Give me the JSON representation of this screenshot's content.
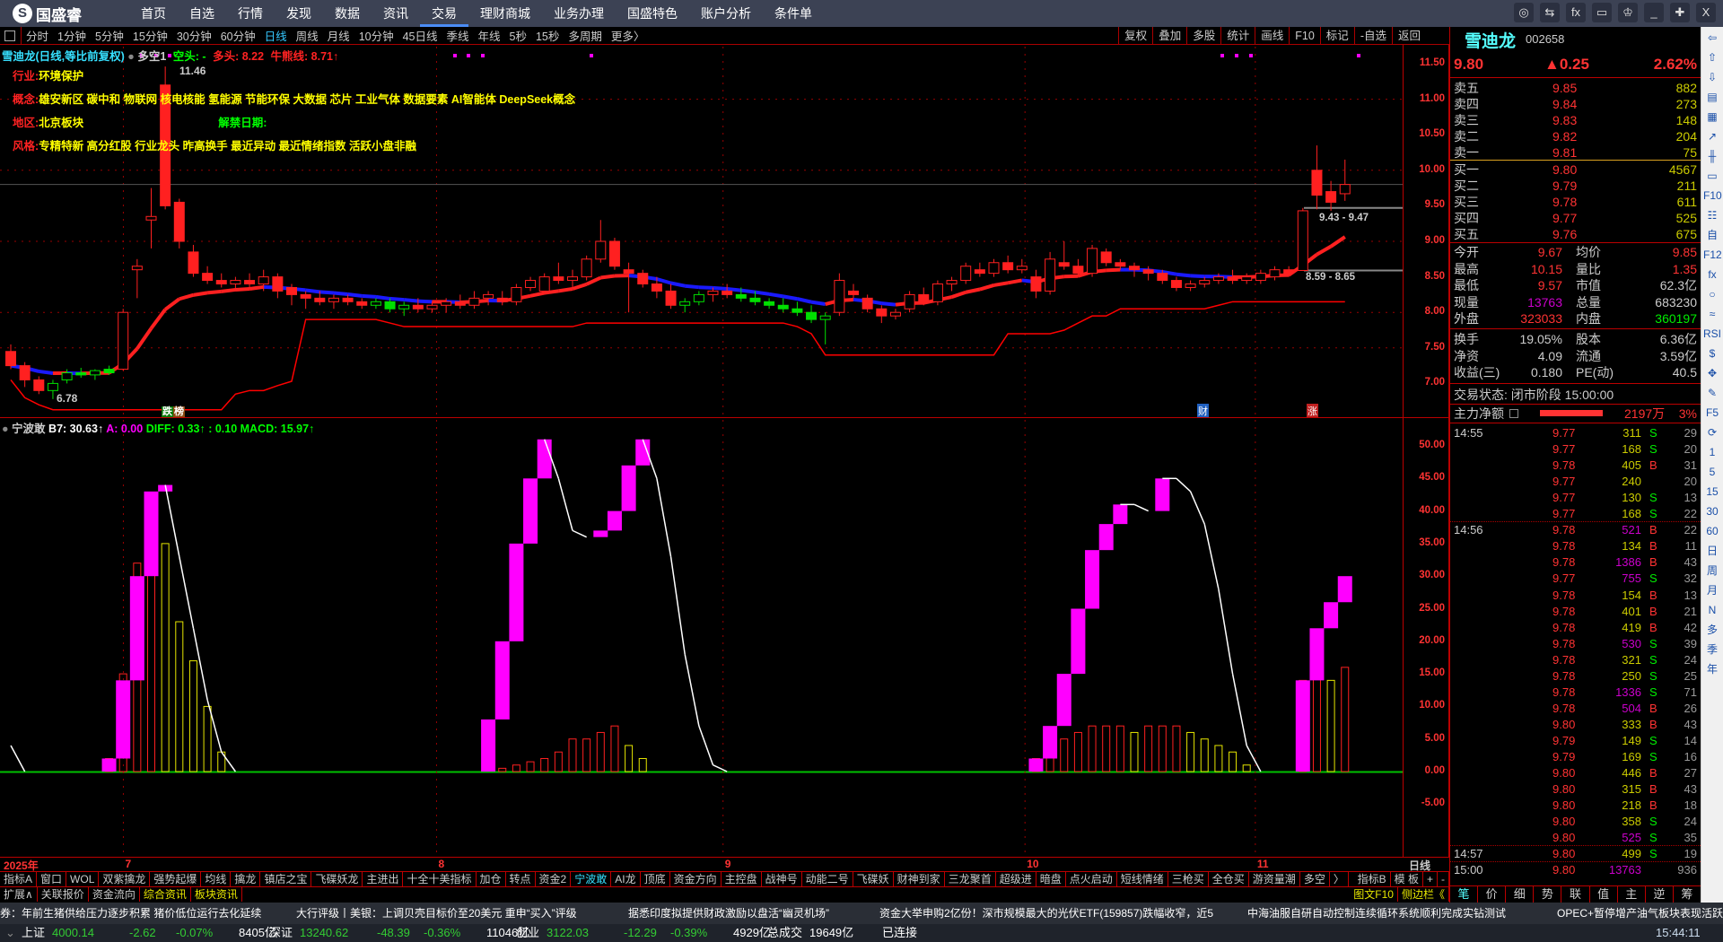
{
  "app": {
    "logo": "国盛睿",
    "nav": [
      "首页",
      "自选",
      "行情",
      "发现",
      "数据",
      "资讯",
      "交易",
      "理财商城",
      "业务办理",
      "国盛特色",
      "账户分析",
      "条件单"
    ],
    "nav_active": 6,
    "window_buttons": [
      "◎",
      "⇆",
      "fx",
      "▭",
      "♔",
      "_",
      "✚",
      "X"
    ]
  },
  "toolbar": {
    "periods": [
      "分时",
      "1分钟",
      "5分钟",
      "15分钟",
      "30分钟",
      "60分钟",
      "日线",
      "周线",
      "月线",
      "10分钟",
      "45日线",
      "季线",
      "年线",
      "5秒",
      "15秒",
      "多周期",
      "更多〉"
    ],
    "active": 6,
    "tools": [
      "复权",
      "叠加",
      "多股",
      "统计",
      "画线",
      "F10",
      "标记",
      "-自选",
      "返回"
    ]
  },
  "main_header": {
    "title": "雪迪龙(日线,等比前复权)",
    "indicator": "多空1",
    "bear": "空头: -",
    "bull": "多头: 8.22",
    "line": "牛熊线: 8.71↑"
  },
  "info": {
    "industry_label": "行业:",
    "industry": "环境保护",
    "concept_label": "概念:",
    "concept": "雄安新区 碳中和 物联网 核电核能 氢能源 节能环保 大数据 芯片 工业气体 数据要素 AI智能体 DeepSeek概念",
    "region_label": "地区:",
    "region": "北京板块",
    "unlock_label": "解禁日期:",
    "style_label": "风格:",
    "style": "专精特新 高分红股 行业龙头 昨高换手 最近异动 最近情绪指数 活跃小盘非融"
  },
  "markers": {
    "high": "11.46",
    "low": "6.78",
    "zone_upper": "9.43 - 9.47",
    "zone_lower": "8.59 - 8.65",
    "badge1": "跌",
    "badge2": "榜",
    "badge_cai": "财",
    "badge_zhang": "涨"
  },
  "price_axis": [
    "11.50",
    "11.00",
    "10.50",
    "10.00",
    "9.50",
    "9.00",
    "8.50",
    "8.00",
    "7.50",
    "7.00"
  ],
  "ind_axis": [
    "50.00",
    "45.00",
    "40.00",
    "35.00",
    "30.00",
    "25.00",
    "20.00",
    "15.00",
    "10.00",
    "5.00",
    "0.00",
    "-5.00"
  ],
  "indicator_header": {
    "name": "宁波敢",
    "b7": "B7: 30.63↑",
    "a": "A: 0.00",
    "diff": "DIFF: 0.33↑",
    "dea": ": 0.10",
    "macd": "MACD: 15.97↑"
  },
  "date_axis": {
    "year": "2025年",
    "months": [
      "7",
      "8",
      "9",
      "10",
      "11"
    ],
    "period": "日线"
  },
  "colors": {
    "up": "#ff2020",
    "down": "#00e000",
    "ma_down": "#1a1aff",
    "magenta": "#ff00ff",
    "yellow": "#e6e600"
  },
  "kline": {
    "ohlc": [
      [
        7.45,
        7.55,
        7.2,
        7.25
      ],
      [
        7.25,
        7.3,
        6.95,
        7.05
      ],
      [
        7.05,
        7.1,
        6.85,
        6.9
      ],
      [
        6.9,
        7.05,
        6.78,
        7.0
      ],
      [
        7.05,
        7.2,
        7.0,
        7.15
      ],
      [
        7.15,
        7.22,
        7.08,
        7.12
      ],
      [
        7.12,
        7.2,
        7.05,
        7.18
      ],
      [
        7.2,
        7.25,
        7.12,
        7.15
      ],
      [
        7.2,
        8.05,
        7.18,
        8.0
      ],
      [
        8.6,
        8.75,
        8.2,
        8.65
      ],
      [
        9.3,
        9.75,
        8.9,
        9.35
      ],
      [
        11.2,
        11.46,
        9.45,
        9.5
      ],
      [
        9.55,
        9.6,
        8.9,
        9.0
      ],
      [
        8.85,
        8.95,
        8.5,
        8.55
      ],
      [
        8.55,
        8.65,
        8.4,
        8.45
      ],
      [
        8.45,
        8.55,
        8.35,
        8.4
      ],
      [
        8.4,
        8.5,
        8.3,
        8.45
      ],
      [
        8.45,
        8.55,
        8.35,
        8.4
      ],
      [
        8.4,
        8.6,
        8.3,
        8.5
      ],
      [
        8.5,
        8.55,
        8.2,
        8.3
      ],
      [
        8.35,
        8.4,
        8.1,
        8.25
      ],
      [
        8.25,
        8.3,
        8.05,
        8.2
      ],
      [
        8.2,
        8.3,
        8.1,
        8.15
      ],
      [
        8.15,
        8.25,
        8.05,
        8.2
      ],
      [
        8.2,
        8.25,
        8.1,
        8.15
      ],
      [
        8.15,
        8.2,
        8.05,
        8.1
      ],
      [
        8.1,
        8.2,
        8.05,
        8.15
      ],
      [
        8.15,
        8.2,
        8.0,
        8.05
      ],
      [
        8.05,
        8.15,
        7.95,
        8.1
      ],
      [
        8.1,
        8.2,
        8.0,
        8.05
      ],
      [
        8.05,
        8.15,
        8.0,
        8.1
      ],
      [
        8.1,
        8.2,
        8.0,
        8.15
      ],
      [
        8.15,
        8.25,
        8.05,
        8.1
      ],
      [
        8.1,
        8.3,
        8.05,
        8.2
      ],
      [
        8.2,
        8.3,
        8.1,
        8.25
      ],
      [
        8.2,
        8.3,
        8.1,
        8.15
      ],
      [
        8.15,
        8.4,
        8.1,
        8.35
      ],
      [
        8.35,
        8.5,
        8.3,
        8.45
      ],
      [
        8.3,
        8.55,
        8.25,
        8.5
      ],
      [
        8.5,
        8.7,
        8.4,
        8.45
      ],
      [
        8.45,
        8.6,
        8.35,
        8.5
      ],
      [
        8.5,
        8.8,
        8.45,
        8.75
      ],
      [
        8.75,
        9.3,
        8.7,
        9.0
      ],
      [
        9.0,
        9.05,
        8.6,
        8.65
      ],
      [
        8.6,
        8.7,
        8.0,
        8.55
      ],
      [
        8.55,
        8.6,
        8.35,
        8.4
      ],
      [
        8.4,
        8.5,
        8.2,
        8.3
      ],
      [
        8.3,
        8.4,
        8.05,
        8.1
      ],
      [
        8.1,
        8.2,
        8.0,
        8.15
      ],
      [
        8.15,
        8.3,
        8.1,
        8.25
      ],
      [
        8.25,
        8.35,
        8.15,
        8.3
      ],
      [
        8.3,
        8.4,
        8.2,
        8.25
      ],
      [
        8.25,
        8.35,
        8.15,
        8.2
      ],
      [
        8.2,
        8.3,
        8.1,
        8.15
      ],
      [
        8.15,
        8.2,
        8.05,
        8.1
      ],
      [
        8.1,
        8.2,
        8.0,
        8.05
      ],
      [
        8.05,
        8.15,
        7.95,
        8.0
      ],
      [
        8.0,
        8.1,
        7.85,
        7.9
      ],
      [
        7.9,
        8.0,
        7.55,
        7.95
      ],
      [
        8.0,
        8.55,
        7.95,
        8.45
      ],
      [
        8.3,
        8.4,
        8.2,
        8.25
      ],
      [
        8.2,
        8.25,
        8.0,
        8.05
      ],
      [
        8.05,
        8.1,
        7.85,
        7.95
      ],
      [
        7.95,
        8.05,
        7.9,
        8.0
      ],
      [
        8.05,
        8.3,
        8.0,
        8.25
      ],
      [
        8.25,
        8.35,
        8.1,
        8.15
      ],
      [
        8.15,
        8.45,
        8.1,
        8.4
      ],
      [
        8.4,
        8.5,
        8.3,
        8.45
      ],
      [
        8.45,
        8.7,
        8.4,
        8.65
      ],
      [
        8.6,
        8.7,
        8.5,
        8.55
      ],
      [
        8.55,
        8.75,
        8.5,
        8.7
      ],
      [
        8.7,
        8.8,
        8.55,
        8.6
      ],
      [
        8.6,
        8.75,
        8.55,
        8.65
      ],
      [
        8.5,
        8.6,
        8.2,
        8.3
      ],
      [
        8.3,
        8.85,
        8.25,
        8.75
      ],
      [
        8.7,
        9.0,
        8.6,
        8.65
      ],
      [
        8.65,
        8.75,
        8.5,
        8.55
      ],
      [
        8.55,
        8.95,
        8.5,
        8.9
      ],
      [
        8.85,
        8.9,
        8.65,
        8.7
      ],
      [
        8.7,
        8.75,
        8.6,
        8.65
      ],
      [
        8.65,
        8.7,
        8.5,
        8.6
      ],
      [
        8.6,
        8.65,
        8.45,
        8.55
      ],
      [
        8.55,
        8.6,
        8.4,
        8.45
      ],
      [
        8.45,
        8.5,
        8.3,
        8.35
      ],
      [
        8.35,
        8.45,
        8.3,
        8.4
      ],
      [
        8.4,
        8.5,
        8.35,
        8.45
      ],
      [
        8.45,
        8.55,
        8.4,
        8.5
      ],
      [
        8.5,
        8.6,
        8.4,
        8.45
      ],
      [
        8.45,
        8.55,
        8.4,
        8.5
      ],
      [
        8.45,
        8.6,
        8.4,
        8.55
      ],
      [
        8.5,
        8.65,
        8.45,
        8.6
      ],
      [
        8.6,
        8.65,
        8.5,
        8.55
      ],
      [
        8.59,
        9.47,
        8.59,
        9.43
      ],
      [
        10.0,
        10.35,
        9.45,
        9.65
      ],
      [
        9.7,
        9.85,
        9.43,
        9.55
      ],
      [
        9.67,
        10.15,
        9.57,
        9.8
      ]
    ],
    "color_codes": "rrrgggggrrrrrrrrrrrrrrrrrrgggrrrrrrrrrrrrrrrrrrrggrrgggggggrrrrrrrrrrrrrrrrrrrrrrrrrrrrrrrrrrr",
    "last_price": 9.8,
    "month_start_index": [
      8.4,
      30.7,
      51.1,
      72.6,
      89
    ]
  },
  "indicator": {
    "b7": [
      4,
      0,
      0,
      0,
      0,
      0,
      0,
      2,
      14,
      30,
      43,
      44,
      33,
      22,
      11,
      3,
      0,
      0,
      0,
      0,
      0,
      0,
      0,
      0,
      0,
      0,
      0,
      0,
      0,
      0,
      0,
      0,
      0,
      0,
      8,
      20,
      35,
      45,
      51,
      45,
      37,
      36,
      37,
      40,
      47,
      51,
      45,
      33,
      18,
      7,
      1,
      0,
      0,
      0,
      0,
      0,
      0,
      0,
      0,
      0,
      0,
      0,
      0,
      0,
      0,
      0,
      0,
      0,
      0,
      0,
      0,
      0,
      0,
      2,
      7,
      15,
      25,
      34,
      38,
      41,
      41,
      40,
      45,
      45,
      43,
      38,
      28,
      15,
      4,
      0,
      0,
      0,
      14,
      22,
      26,
      30
    ],
    "bars": [
      0,
      0,
      0,
      0,
      0,
      0,
      0,
      2,
      15,
      32,
      40,
      35,
      23,
      17,
      10,
      3,
      0,
      0,
      0,
      0,
      0,
      0,
      0,
      0,
      0,
      0,
      0,
      0,
      0,
      0,
      0,
      0,
      0,
      0,
      0,
      0.5,
      1,
      1.5,
      2,
      3,
      5,
      5,
      6,
      7,
      4,
      2,
      0,
      0,
      0,
      0,
      0,
      0,
      0,
      0,
      0,
      0,
      0,
      0,
      0,
      0,
      0,
      0,
      0,
      0,
      0,
      0,
      0,
      0,
      0,
      0,
      0,
      0,
      0,
      2,
      4,
      5,
      6,
      7,
      7,
      7,
      6,
      7,
      7,
      7,
      6,
      5,
      4,
      3,
      1,
      0,
      0,
      0,
      14,
      15,
      14,
      16
    ]
  },
  "quote": {
    "name": "雪迪龙",
    "code": "002658",
    "price": "9.80",
    "change": "▲0.25",
    "pct": "2.62%",
    "asks": [
      {
        "label": "卖五",
        "price": "9.85",
        "vol": "882"
      },
      {
        "label": "卖四",
        "price": "9.84",
        "vol": "273"
      },
      {
        "label": "卖三",
        "price": "9.83",
        "vol": "148"
      },
      {
        "label": "卖二",
        "price": "9.82",
        "vol": "204"
      },
      {
        "label": "卖一",
        "price": "9.81",
        "vol": "75"
      }
    ],
    "bids": [
      {
        "label": "买一",
        "price": "9.80",
        "vol": "4567"
      },
      {
        "label": "买二",
        "price": "9.79",
        "vol": "211"
      },
      {
        "label": "买三",
        "price": "9.78",
        "vol": "611"
      },
      {
        "label": "买四",
        "price": "9.77",
        "vol": "525"
      },
      {
        "label": "买五",
        "price": "9.76",
        "vol": "675"
      }
    ],
    "stats1": [
      [
        "今开",
        "9.67",
        "#ff3333",
        "均价",
        "9.85",
        "#ff3333"
      ],
      [
        "最高",
        "10.15",
        "#ff3333",
        "量比",
        "1.35",
        "#ff3333"
      ],
      [
        "最低",
        "9.57",
        "#ff3333",
        "市值",
        "62.3亿",
        "#ccc"
      ],
      [
        "现量",
        "13763",
        "#cc00cc",
        "总量",
        "683230",
        "#ccc"
      ],
      [
        "外盘",
        "323033",
        "#ff3333",
        "内盘",
        "360197",
        "#00ee00"
      ]
    ],
    "stats2": [
      [
        "换手",
        "19.05%",
        "#ccc",
        "股本",
        "6.36亿",
        "#ccc"
      ],
      [
        "净资",
        "4.09",
        "#ccc",
        "流通",
        "3.59亿",
        "#ccc"
      ],
      [
        "收益(三)",
        "0.180",
        "#ccc",
        "PE(动)",
        "40.5",
        "#ccc"
      ]
    ],
    "trade_state": "交易状态: 闭市阶段 15:00:00",
    "main_flow": {
      "label": "主力净额",
      "value": "2197万",
      "pct": "3%"
    }
  },
  "trades": [
    [
      "14:55",
      "9.77",
      "311",
      "S",
      "29"
    ],
    [
      "",
      "9.77",
      "168",
      "S",
      "20"
    ],
    [
      "",
      "9.78",
      "405",
      "B",
      "31"
    ],
    [
      "",
      "9.77",
      "240",
      "",
      "20"
    ],
    [
      "",
      "9.77",
      "130",
      "S",
      "13"
    ],
    [
      "",
      "9.77",
      "168",
      "S",
      "22"
    ],
    [
      "14:56",
      "9.78",
      "521",
      "B",
      "22"
    ],
    [
      "",
      "9.78",
      "134",
      "B",
      "11"
    ],
    [
      "",
      "9.78",
      "1386",
      "B",
      "43"
    ],
    [
      "",
      "9.77",
      "755",
      "S",
      "32"
    ],
    [
      "",
      "9.78",
      "154",
      "B",
      "13"
    ],
    [
      "",
      "9.78",
      "401",
      "B",
      "21"
    ],
    [
      "",
      "9.78",
      "419",
      "B",
      "42"
    ],
    [
      "",
      "9.78",
      "530",
      "S",
      "39"
    ],
    [
      "",
      "9.78",
      "321",
      "S",
      "24"
    ],
    [
      "",
      "9.78",
      "250",
      "S",
      "25"
    ],
    [
      "",
      "9.78",
      "1336",
      "S",
      "71"
    ],
    [
      "",
      "9.78",
      "504",
      "B",
      "26"
    ],
    [
      "",
      "9.80",
      "333",
      "B",
      "43"
    ],
    [
      "",
      "9.79",
      "149",
      "S",
      "14"
    ],
    [
      "",
      "9.79",
      "169",
      "S",
      "16"
    ],
    [
      "",
      "9.80",
      "446",
      "B",
      "27"
    ],
    [
      "",
      "9.80",
      "315",
      "B",
      "43"
    ],
    [
      "",
      "9.80",
      "218",
      "B",
      "18"
    ],
    [
      "",
      "9.80",
      "358",
      "S",
      "24"
    ],
    [
      "",
      "9.80",
      "525",
      "S",
      "35"
    ],
    [
      "14:57",
      "9.80",
      "499",
      "S",
      "19"
    ],
    [
      "15:00",
      "9.80",
      "13763",
      "",
      "936"
    ]
  ],
  "rp_tabs": [
    "笔",
    "价",
    "细",
    "势",
    "联",
    "值",
    "主",
    "逆",
    "筹"
  ],
  "side_icons": [
    "⇦",
    "⇧",
    "⇩",
    "▤",
    "▦",
    "↗",
    "╫",
    "▭",
    "F10",
    "☷",
    "自",
    "F12",
    "fx",
    "○",
    "≈",
    "RSI",
    "$",
    "✥",
    "✎",
    "F5",
    "⟳",
    "1",
    "5",
    "15",
    "30",
    "60",
    "日",
    "周",
    "月",
    "N",
    "多",
    "季",
    "年"
  ],
  "tabs_row1": [
    "指标A",
    "窗口",
    "WOL",
    "双紫擒龙",
    "强势起爆",
    "均线",
    "擒龙",
    "镇店之宝",
    "飞碟妖龙",
    "主进出",
    "十全十美指标",
    "加仓",
    "转点",
    "资金2",
    "宁波敢",
    "AI龙",
    "顶底",
    "资金方向",
    "主控盘",
    "战神号",
    "动能二号",
    "飞碟妖",
    "财神到家",
    "三龙聚首",
    "超级进",
    "暗盘",
    "点火启动",
    "短线情绪",
    "三枪买",
    "全仓买",
    "游资量潮",
    "多空",
    "〉"
  ],
  "tabs_row1_active": 14,
  "tabs_row1_right": [
    "指标B",
    "模 板",
    "+",
    "-"
  ],
  "tabs_row2": [
    "扩展∧",
    "关联报价",
    "资金流向",
    "综合资讯",
    "板块资讯"
  ],
  "tabs_row2_right": [
    "图文F10",
    "侧边栏《"
  ],
  "news": [
    "券：年前生猪供给压力逐步积累 猪价低位运行去化延续",
    "大行评级丨美银：上调贝壳目标价至20美元 重申“买入”评级",
    "据悉印度拟提供财政激励以盘活“幽灵机场”",
    "资金大举申购2亿份！深市规模最大的光伏ETF(159857)跌幅收窄，近5",
    "中海油服自研自动控制连续循环系统顺利完成实钻测试",
    "OPEC+暂停增产油气板块表现活跃"
  ],
  "status": {
    "sh": [
      "上证",
      "4000.14",
      "-2.62",
      "-0.07%",
      "8405亿"
    ],
    "sz": [
      "深证",
      "13240.62",
      "-48.39",
      "-0.36%",
      "11046亿"
    ],
    "cy": [
      "创业",
      "3122.03",
      "-12.29",
      "-0.39%",
      "4929亿"
    ],
    "total_label": "总成交",
    "total": "19649亿",
    "conn": "已连接",
    "clock": "15:44:11"
  }
}
